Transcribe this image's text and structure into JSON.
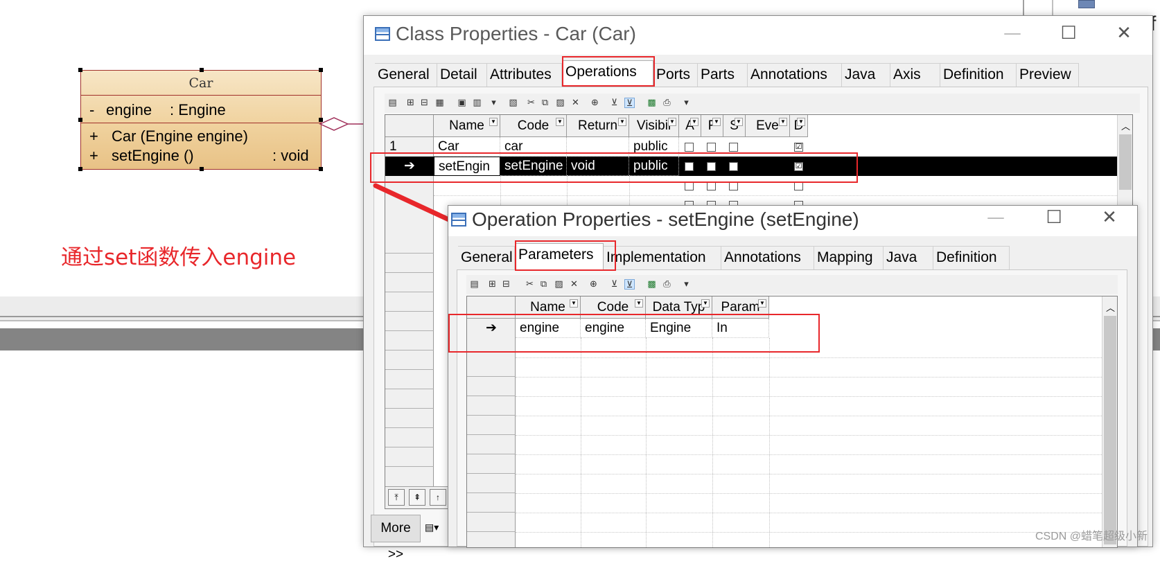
{
  "uml_class": {
    "name": "Car",
    "attribute": {
      "visibility": "-",
      "name": "engine",
      "type": ": Engine"
    },
    "operations": [
      {
        "visibility": "+",
        "signature": "Car (Engine engine)",
        "type": ""
      },
      {
        "visibility": "+",
        "signature": "setEngine ()",
        "type": ": void"
      }
    ]
  },
  "annotation_text": "通过set函数传入engine",
  "class_window": {
    "title": "Class Properties - Car (Car)",
    "controls": {
      "minimize": "—",
      "maximize": "☐",
      "close": "✕"
    },
    "tabs": [
      "General",
      "Detail",
      "Attributes",
      "Operations",
      "Ports",
      "Parts",
      "Annotations",
      "Java",
      "Axis",
      "Definition",
      "Preview"
    ],
    "active_tab": "Operations",
    "columns": [
      "Name",
      "Code",
      "Return",
      "Visibil",
      "A",
      "F",
      "S",
      "Eve",
      "D"
    ],
    "rows": [
      {
        "marker": "1",
        "name": "Car",
        "code": "car",
        "return": "",
        "visibility": "public",
        "checks": [
          "",
          "",
          "",
          "☑"
        ]
      },
      {
        "marker": "➔",
        "name": "setEngin",
        "code": "setEngine",
        "return": "void",
        "visibility": "public",
        "checks": [
          "",
          "",
          "",
          "☑"
        ]
      }
    ],
    "more_button": "More >>",
    "nav": [
      "⤒",
      "⇞",
      "↑"
    ]
  },
  "op_window": {
    "title": "Operation Properties - setEngine (setEngine)",
    "controls": {
      "minimize": "—",
      "maximize": "☐",
      "close": "✕"
    },
    "tabs": [
      "General",
      "Parameters",
      "Implementation",
      "Annotations",
      "Mapping",
      "Java",
      "Definition"
    ],
    "active_tab": "Parameters",
    "columns": [
      "Name",
      "Code",
      "Data Typ",
      "Param"
    ],
    "rows": [
      {
        "marker": "➔",
        "name": "engine",
        "code": "engine",
        "data_type": "Engine",
        "param": "In"
      }
    ]
  },
  "partial_text_right": "f",
  "watermark": "CSDN @蜡笔超级小新",
  "colors": {
    "annotation": "#e8272b",
    "uml_border": "#a0302a",
    "selection": "#000000"
  }
}
